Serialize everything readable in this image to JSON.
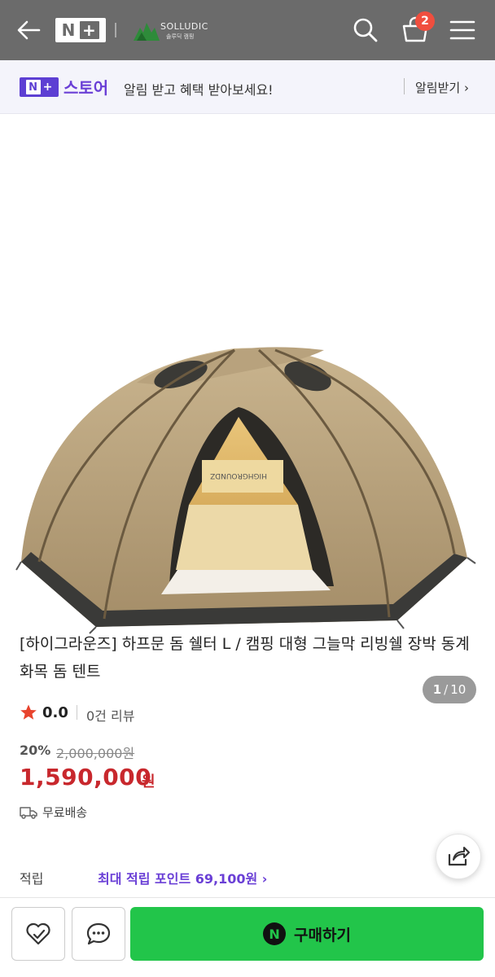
{
  "header": {
    "logo_n": "N",
    "logo_plus": "+",
    "brand": "SOLLUDIC",
    "brand_sub": "솔루딕 캠핑",
    "cart_count": "2"
  },
  "store_banner": {
    "badge_n": "N",
    "badge_plus": "+",
    "store_name": "스토어",
    "message": "알림 받고 혜택 받아보세요!",
    "alert_link": "알림받기 ›"
  },
  "gallery": {
    "current": "1",
    "separator": "/",
    "total": "10",
    "tent_print": "HIGHGROUNDZ"
  },
  "product": {
    "title": "[하이그라운즈] 하프문 돔 쉘터 L / 캠핑 대형 그늘막 리빙쉘 장박 동계 화목 돔 텐트",
    "rating": "0.0",
    "review_count": "0건 리뷰",
    "discount": "20%",
    "original_price": "2,000,000원",
    "sale_price": "1,590,000",
    "currency": "원",
    "shipping": "무료배송",
    "points_label": "적립",
    "points_value": "최대 적립 포인트 69,100원 ›"
  },
  "bottom_bar": {
    "buy_icon": "N",
    "buy_label": "구매하기"
  },
  "colors": {
    "header_bg": "#6b6b6b",
    "accent_purple": "#6a3fd6",
    "price_red": "#c8282d",
    "buy_green": "#22c54a",
    "badge_red": "#f04e3e"
  },
  "icons": [
    "back-arrow-icon",
    "search-icon",
    "cart-icon",
    "menu-icon",
    "star-icon",
    "truck-icon",
    "share-icon",
    "heart-check-icon",
    "chat-icon"
  ]
}
